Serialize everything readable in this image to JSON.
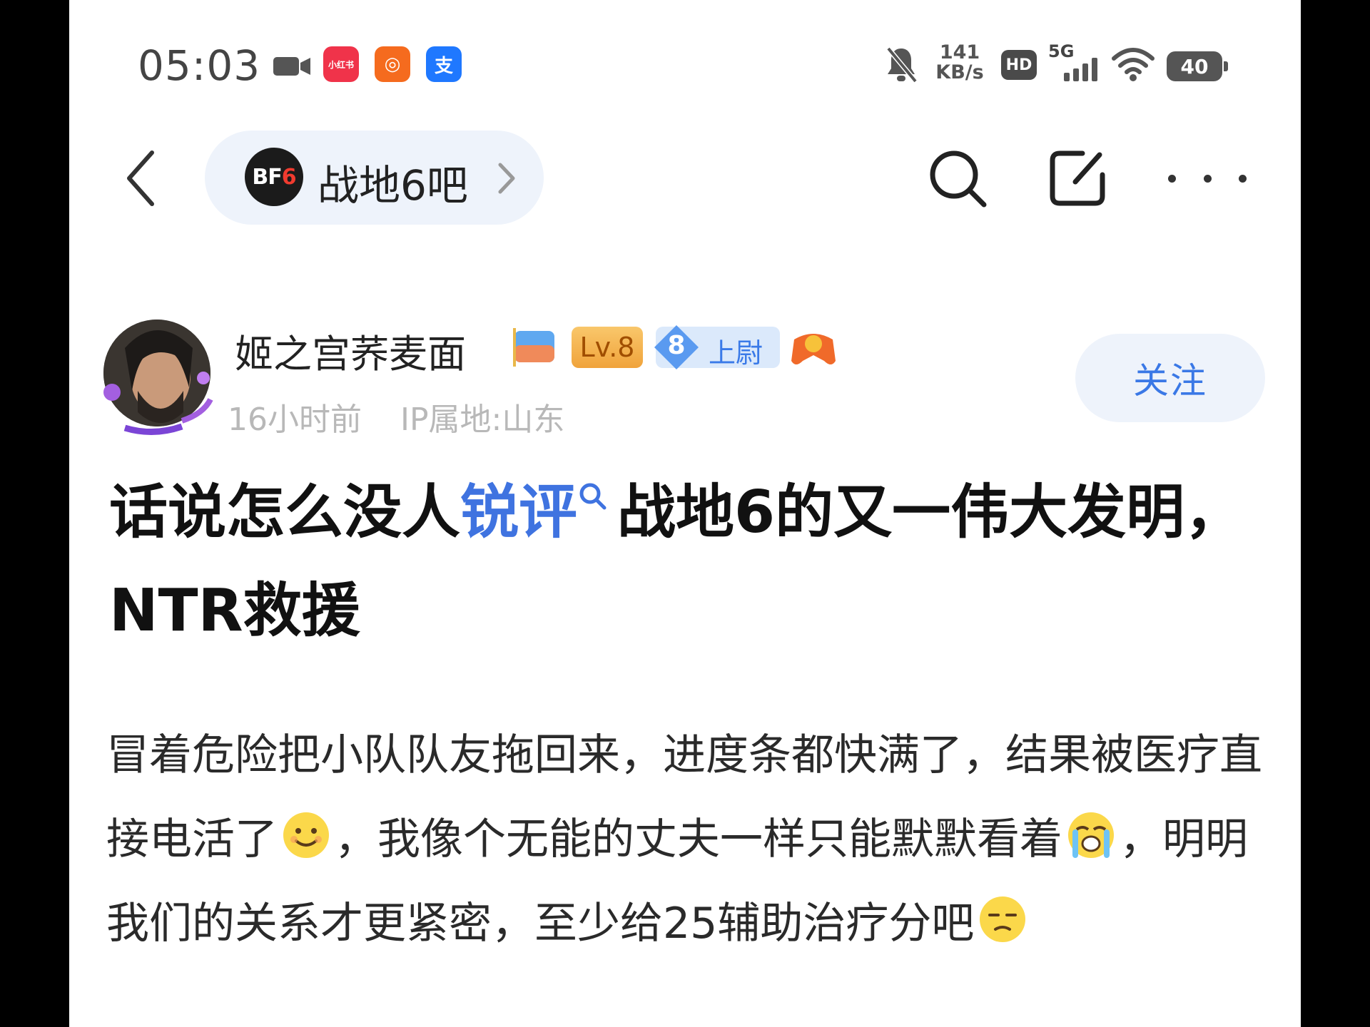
{
  "status_bar": {
    "time": "05:03",
    "apps": [
      {
        "icon": "red-app-icon",
        "label": "小红书"
      },
      {
        "icon": "orange-app-icon",
        "label": "◎"
      },
      {
        "icon": "blue-app-icon",
        "label": "支"
      }
    ],
    "net_speed_value": "141",
    "net_speed_unit": "KB/s",
    "hd_label": "HD",
    "network_type": "5G",
    "battery": "40"
  },
  "header": {
    "forum_logo_prefix": "BF",
    "forum_logo_suffix": "6",
    "forum_name": "战地6吧"
  },
  "author": {
    "username": "姬之宫荞麦面",
    "level": "Lv.8",
    "rank_number": "8",
    "rank_title": "上尉",
    "time_ago": "16小时前",
    "ip_location": "IP属地:山东",
    "follow_label": "关注"
  },
  "post": {
    "title_part1": "话说怎么没人",
    "title_topic": "锐评",
    "title_part2": "战地6的又一伟大发明，NTR救援",
    "body_part1": "冒着危险把小队队友拖回来，进度条都快满了，结果被医疗直接电活了",
    "body_part2": "，我像个无能的丈夫一样只能默默看着",
    "body_part3": "，明明我们的关系才更紧密，至少给25辅助治疗分吧",
    "emojis": [
      "smile-emoji",
      "crying-emoji",
      "annoyed-emoji"
    ]
  },
  "colors": {
    "accent_blue": "#3f73e0",
    "pill_bg": "#eef3fb",
    "level_badge": "#f0a33b",
    "rank_badge_bg": "#dbe9fb"
  }
}
